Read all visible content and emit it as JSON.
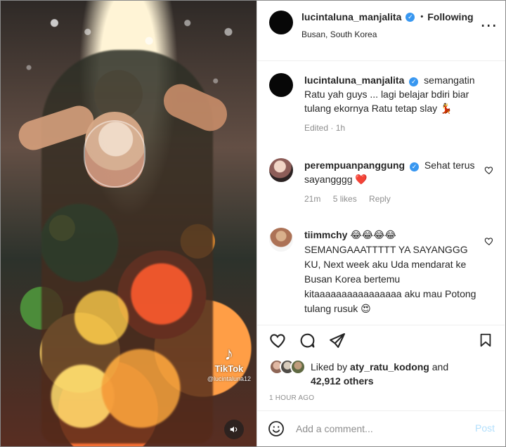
{
  "post": {
    "header": {
      "username": "lucintaluna_manjalita",
      "separator": "•",
      "follow_status": "Following",
      "location": "Busan, South Korea"
    },
    "media": {
      "watermark": "TikTok",
      "watermark_user": "@lucintaluna12",
      "mute_icon": "speaker-icon"
    },
    "caption": {
      "username": "lucintaluna_manjalita",
      "text": "semangatin Ratu yah guys ... lagi belajar bdiri biar tulang ekornya Ratu tetap slay 💃",
      "meta": "Edited · 1h"
    },
    "comments": [
      {
        "username": "perempuanpanggung",
        "text": "Sehat terus sayangggg ❤️",
        "time": "21m",
        "likes": "5 likes",
        "reply": "Reply"
      },
      {
        "username": "tiimmchy",
        "text": "😂😂😂😂 SEMANGAAATTTTT YA SAYANGGG KU, Next week aku Uda mendarat ke Busan Korea bertemu kitaaaaaaaaaaaaaaaa aku mau Potong tulang rusuk 😍"
      }
    ],
    "likes_line": {
      "prefix": "Liked by",
      "user": "aty_ratu_kodong",
      "connector": "and",
      "others": "42,912 others"
    },
    "time_ago": "1 HOUR AGO",
    "comment_box": {
      "placeholder": "Add a comment...",
      "post_label": "Post"
    },
    "colors": {
      "primary_text": "#262626",
      "secondary_text": "#8e8e8e",
      "verified_blue": "#3897f0",
      "post_button_disabled": "#b2dffc"
    }
  }
}
